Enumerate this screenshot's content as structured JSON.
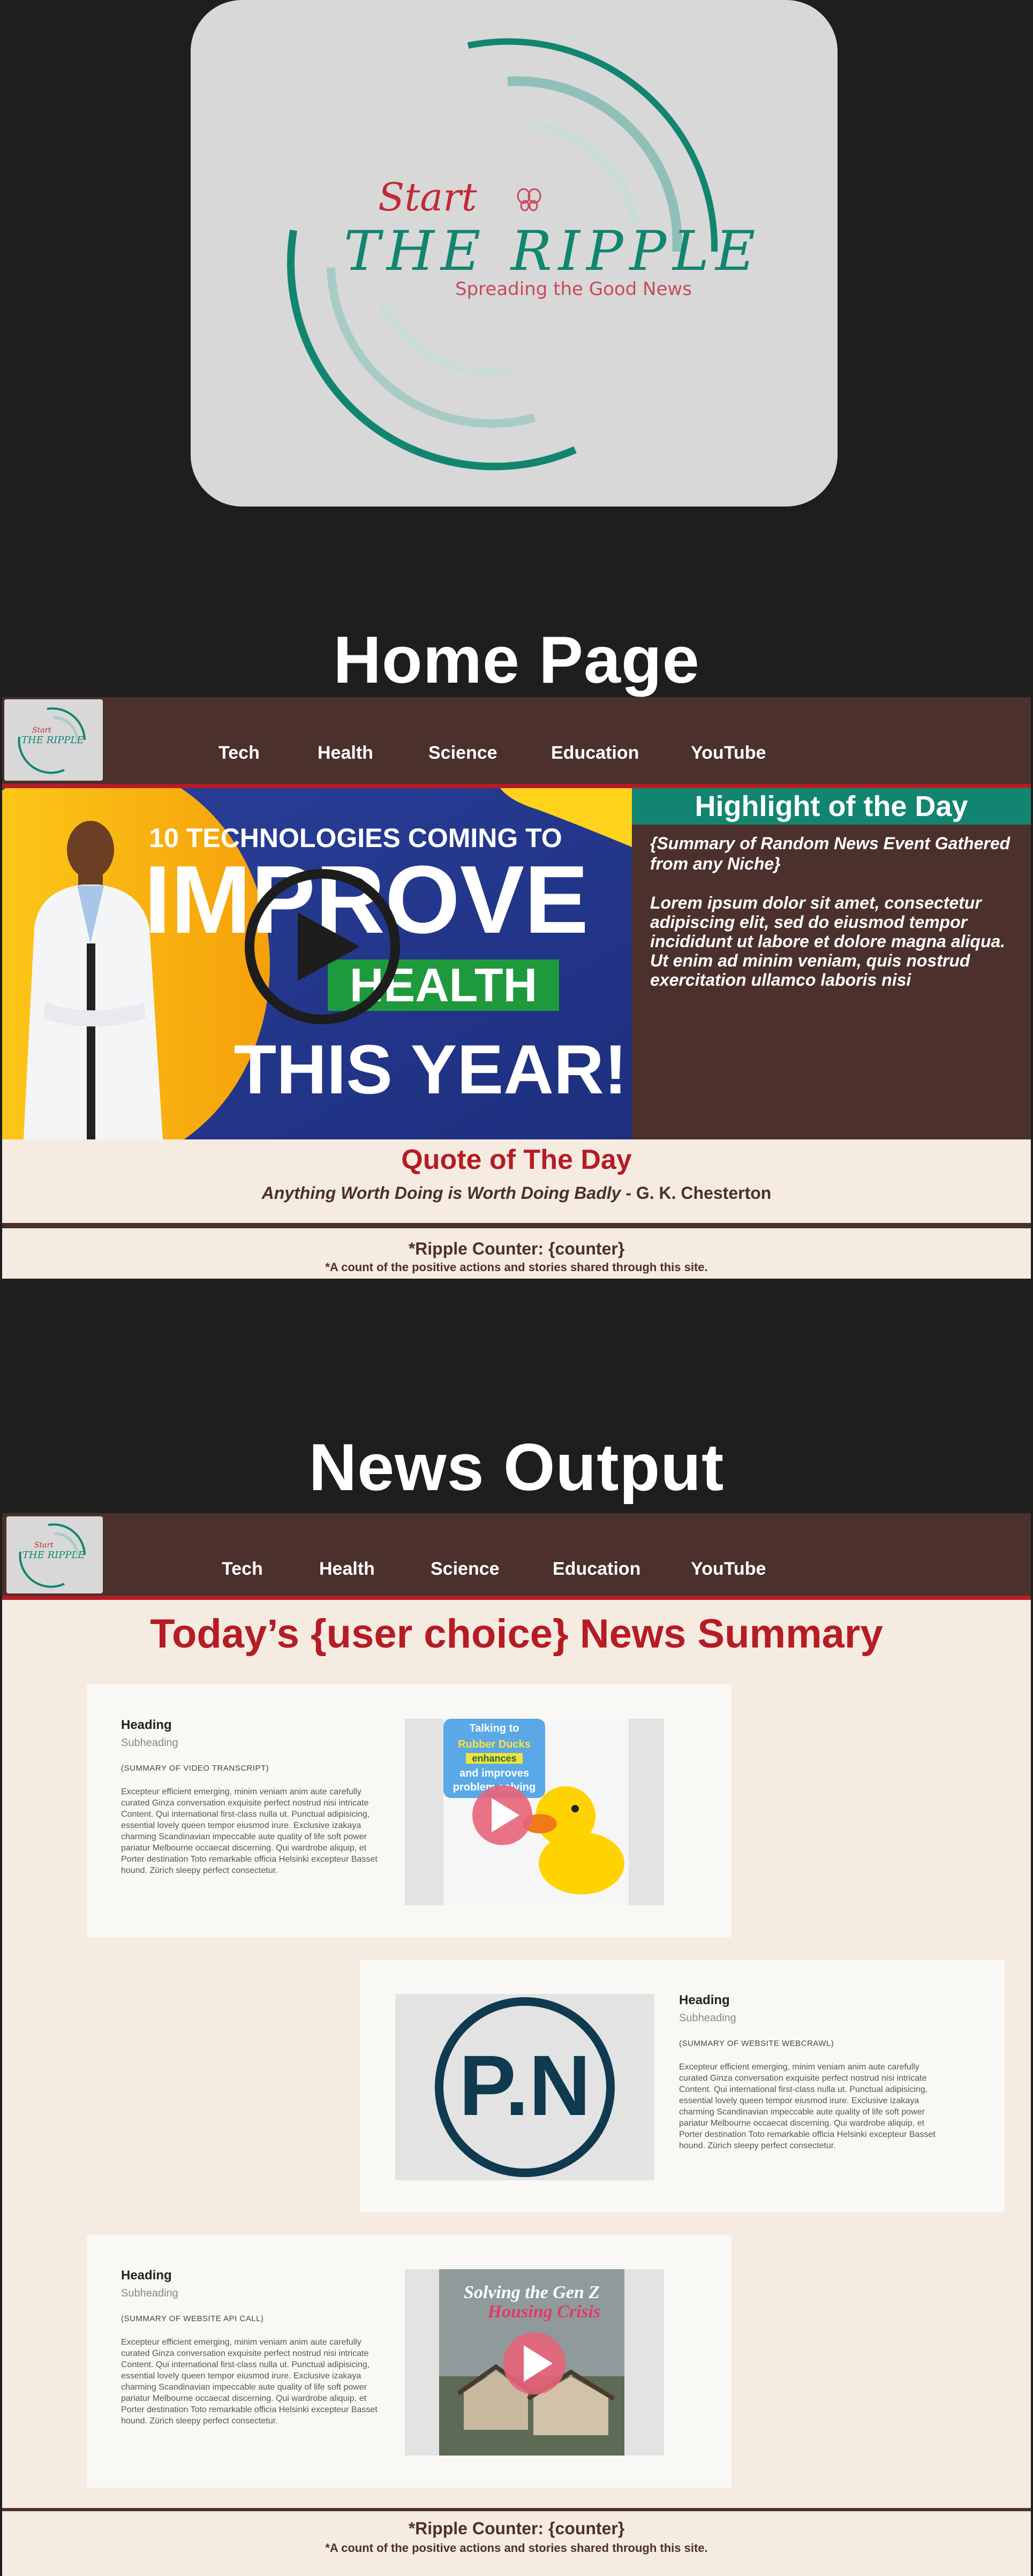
{
  "brand": {
    "script": "Start",
    "name": "THE RIPPLE",
    "tagline": "Spreading the Good News",
    "colors": {
      "teal": "#128570",
      "red": "#b51c24",
      "brown": "#4b302b",
      "cream": "#f5ebe1"
    }
  },
  "sections": {
    "home_title": "Home Page",
    "news_title": "News Output"
  },
  "nav": {
    "items": [
      "Tech",
      "Health",
      "Science",
      "Education",
      "YouTube"
    ]
  },
  "hero": {
    "line1": "10 TECHNOLOGIES COMING TO",
    "line2": "IMPROVE",
    "line3": "HEALTH",
    "line4": "THIS YEAR!"
  },
  "highlight": {
    "title": "Highlight of the Day",
    "summary": "{Summary of Random News Event Gathered from any Niche}",
    "body": "Lorem ipsum dolor sit amet, consectetur adipiscing elit, sed do eiusmod  tempor incididunt ut labore et dolore magna aliqua. Ut enim ad minim  veniam, quis nostrud exercitation ullamco laboris nisi"
  },
  "quote": {
    "title": "Quote of The Day",
    "text": "Anything Worth Doing is Worth Doing Badly",
    "author": " - G. K. Chesterton"
  },
  "counter": {
    "title": "*Ripple Counter: {counter}",
    "note": "*A count of the positive actions and stories shared through this site."
  },
  "news": {
    "heading": "Today’s {user choice} News Summary",
    "cards": [
      {
        "heading": "Heading",
        "subheading": "Subheading",
        "tag": "(SUMMARY OF VIDEO TRANSCRIPT)",
        "body": "Excepteur efficient emerging, minim veniam anim aute carefully curated Ginza conversation exquisite perfect nostrud nisi intricate Content. Qui  international first-class nulla ut. Punctual adipisicing, essential lovely queen tempor eiusmod irure. Exclusive izakaya charming Scandinavian impeccable aute quality of life soft power pariatur Melbourne occaecat discerning. Qui wardrobe aliquip, et Porter destination Toto remarkable officia Helsinki excepteur Basset hound. Zürich sleepy perfect consectetur.",
        "media": {
          "l1": "Talking to",
          "l2": "Rubber Ducks",
          "l3": "enhances",
          "l4": "and improves",
          "l5": "problem solving"
        }
      },
      {
        "heading": "Heading",
        "subheading": "Subheading",
        "tag": "(SUMMARY OF WEBSITE WEBCRAWL)",
        "body": "Excepteur efficient emerging, minim veniam anim aute carefully curated Ginza conversation exquisite perfect nostrud nisi intricate Content. Qui  international first-class nulla ut. Punctual adipisicing, essential lovely queen tempor eiusmod irure. Exclusive izakaya charming Scandinavian impeccable aute quality of life soft power pariatur Melbourne occaecat discerning. Qui wardrobe aliquip, et Porter destination Toto remarkable officia Helsinki excepteur Basset hound. Zürich sleepy perfect consectetur.",
        "media": {
          "logo": "P.N"
        }
      },
      {
        "heading": "Heading",
        "subheading": "Subheading",
        "tag": "(SUMMARY OF WEBSITE API CALL)",
        "body": "Excepteur efficient emerging, minim veniam anim aute carefully curated Ginza conversation exquisite perfect nostrud nisi intricate Content. Qui  international first-class nulla ut. Punctual adipisicing, essential lovely queen tempor eiusmod irure. Exclusive izakaya charming Scandinavian impeccable aute quality of life soft power pariatur Melbourne occaecat discerning. Qui wardrobe aliquip, et Porter destination Toto remarkable officia Helsinki excepteur Basset hound. Zürich sleepy perfect consectetur.",
        "media": {
          "l1": "Solving the Gen Z",
          "l2": "Housing Crisis"
        }
      }
    ]
  },
  "icons": [
    "play-icon",
    "butterfly-icon"
  ]
}
